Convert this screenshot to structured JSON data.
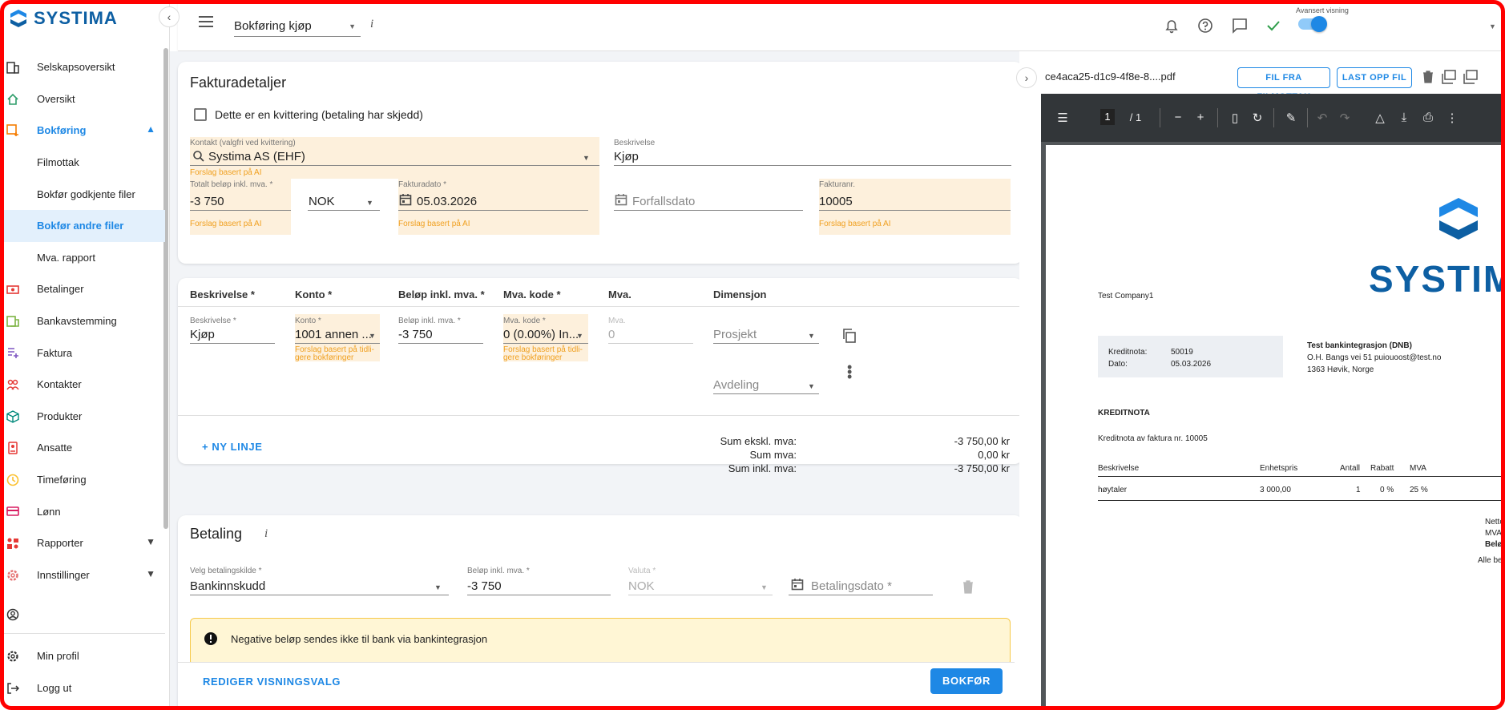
{
  "app": {
    "name": "SYSTIMA"
  },
  "sidebar": {
    "items": [
      {
        "label": "Selskapsoversikt",
        "icon": "building-icon",
        "color": "#333333"
      },
      {
        "label": "Oversikt",
        "icon": "home-icon",
        "color": "#2e9d6a"
      },
      {
        "label": "Bokføring",
        "icon": "bookkeeping-icon",
        "color": "#f57c00",
        "expanded": true
      },
      {
        "label": "Filmottak"
      },
      {
        "label": "Bokfør godkjente filer"
      },
      {
        "label": "Bokfør andre filer",
        "selected": true
      },
      {
        "label": "Mva. rapport"
      },
      {
        "label": "Betalinger",
        "icon": "payments-icon",
        "color": "#e53935"
      },
      {
        "label": "Bankavstemming",
        "icon": "bank-icon",
        "color": "#7cb342"
      },
      {
        "label": "Faktura",
        "icon": "invoice-icon",
        "color": "#7e57c2"
      },
      {
        "label": "Kontakter",
        "icon": "contacts-icon",
        "color": "#e53935"
      },
      {
        "label": "Produkter",
        "icon": "products-icon",
        "color": "#00897b"
      },
      {
        "label": "Ansatte",
        "icon": "employees-icon",
        "color": "#e53935"
      },
      {
        "label": "Timeføring",
        "icon": "clock-icon",
        "color": "#fbc02d"
      },
      {
        "label": "Lønn",
        "icon": "salary-icon",
        "color": "#d81b60"
      },
      {
        "label": "Rapporter",
        "icon": "reports-icon",
        "color": "#e53935"
      },
      {
        "label": "Innstillinger",
        "icon": "gear-icon",
        "color": "#e57373"
      }
    ],
    "bottom": [
      {
        "label": "Min profil",
        "icon": "profile-gear-icon"
      },
      {
        "label": "Logg ut",
        "icon": "logout-icon"
      }
    ]
  },
  "topbar": {
    "page_select": "Bokføring kjøp",
    "info": "i",
    "advanced_label": "Avansert visning",
    "advanced_on": true
  },
  "invoice": {
    "title": "Fakturadetaljer",
    "receipt_checkbox": "Dette er en kvittering (betaling har skjedd)",
    "contact_label": "Kontakt (valgfri ved kvittering)",
    "contact_value": "Systima AS (EHF)",
    "ai_hint": "Forslag basert på AI",
    "description_label": "Beskrivelse",
    "description_value": "Kjøp",
    "total_label": "Totalt beløp inkl. mva. *",
    "total_value": "-3 750",
    "currency_value": "NOK",
    "invoice_date_label": "Fakturadato *",
    "invoice_date_value": "05.03.2026",
    "due_date_placeholder": "Forfallsdato",
    "invoice_no_label": "Fakturanr.",
    "invoice_no_value": "10005"
  },
  "lines": {
    "headers": [
      "Beskrivelse *",
      "Konto *",
      "Beløp inkl. mva. *",
      "Mva. kode *",
      "Mva.",
      "Dimensjon"
    ],
    "row": {
      "desc_label": "Beskrivelse *",
      "desc_value": "Kjøp",
      "account_label": "Konto *",
      "account_value": "1001 annen ...",
      "account_hint": "Forslag basert på tidli-\ngere bokføringer",
      "amount_label": "Beløp inkl. mva. *",
      "amount_value": "-3 750",
      "vat_code_label": "Mva. kode *",
      "vat_code_value": "0 (0.00%) In...",
      "vat_code_hint": "Forslag basert på tidli-\ngere bokføringer",
      "vat_label": "Mva.",
      "vat_value": "0",
      "project_placeholder": "Prosjekt",
      "department_placeholder": "Avdeling"
    },
    "new_line": "+ NY LINJE",
    "sums": [
      {
        "label": "Sum ekskl. mva:",
        "value": "-3 750,00 kr"
      },
      {
        "label": "Sum mva:",
        "value": "0,00 kr"
      },
      {
        "label": "Sum inkl. mva:",
        "value": "-3 750,00 kr"
      }
    ]
  },
  "payment": {
    "title": "Betaling",
    "info": "i",
    "source_label": "Velg betalingskilde *",
    "source_value": "Bankinnskudd",
    "amount_label": "Beløp inkl. mva. *",
    "amount_value": "-3 750",
    "currency_label": "Valuta *",
    "currency_value": "NOK",
    "date_placeholder": "Betalingsdato *",
    "warning": "Negative beløp sendes ikke til bank via bankintegrasjon"
  },
  "actions": {
    "edit_view": "REDIGER VISNINGSVALG",
    "post": "BOKFØR"
  },
  "pdf": {
    "filename": "ce4aca25-d1c9-4f8e-8....pdf",
    "btn_inbox": "FIL FRA FILMOTTAK",
    "btn_upload": "LAST OPP FIL",
    "page_current": "1",
    "page_total": "/  1",
    "doc": {
      "logo_text": "SYSTIM",
      "company": "Test Company1",
      "credit_label": "Kreditnota:",
      "credit_value": "50019",
      "date_label": "Dato:",
      "date_value": "05.03.2026",
      "recipient_name": "Test bankintegrasjon (DNB)",
      "recipient_line1": "O.H. Bangs vei 51 puiouoost@test.no",
      "recipient_line2": "1363 Høvik, Norge",
      "heading": "KREDITNOTA",
      "subheading": "Kreditnota av faktura nr. 10005",
      "table_headers": [
        "Beskrivelse",
        "Enhetspris",
        "Antall",
        "Rabatt",
        "MVA"
      ],
      "table_row": [
        "høytaler",
        "3 000,00",
        "1",
        "0 %",
        "25 %"
      ],
      "totals": [
        "Netto:",
        "MVA:",
        "Beløp:"
      ],
      "footer": "Alle beløp"
    }
  },
  "colors": {
    "accent": "#1e88e5",
    "ai_background": "#fdf0dc",
    "ai_text": "#f0a020",
    "brand": "#0d5fa3"
  }
}
